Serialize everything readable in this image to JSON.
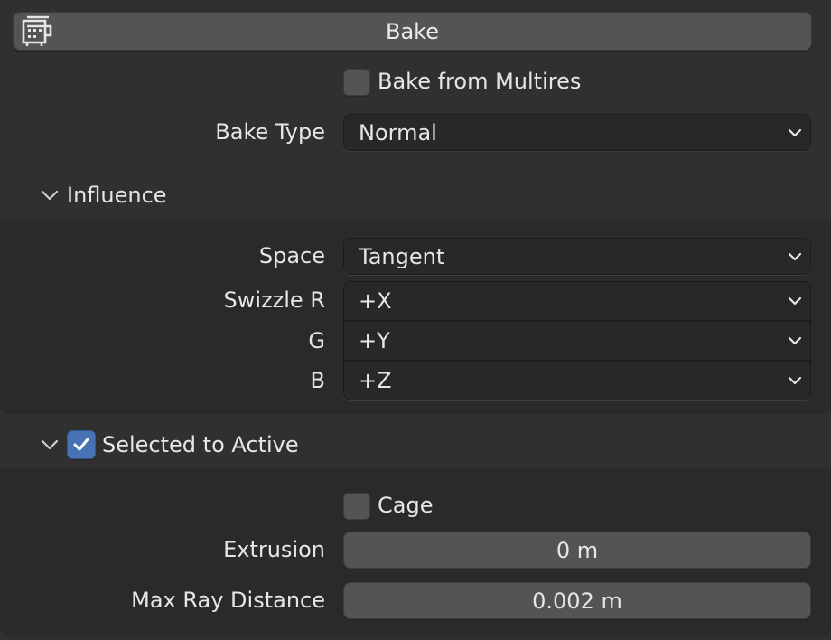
{
  "bake_button": {
    "label": "Bake",
    "icon": "render-bake-icon"
  },
  "bake_from_multires": {
    "label": "Bake from Multires",
    "checked": false
  },
  "bake_type": {
    "label": "Bake Type",
    "value": "Normal"
  },
  "influence": {
    "title": "Influence",
    "expanded": true,
    "space": {
      "label": "Space",
      "value": "Tangent"
    },
    "swizzle_r": {
      "label": "Swizzle R",
      "value": "+X"
    },
    "swizzle_g": {
      "label": "G",
      "value": "+Y"
    },
    "swizzle_b": {
      "label": "B",
      "value": "+Z"
    }
  },
  "selected_to_active": {
    "title": "Selected to Active",
    "expanded": true,
    "enabled": true,
    "cage": {
      "label": "Cage",
      "checked": false
    },
    "extrusion": {
      "label": "Extrusion",
      "value": "0 m"
    },
    "max_ray_distance": {
      "label": "Max Ray Distance",
      "value": "0.002 m"
    }
  },
  "colors": {
    "panel_bg": "#303030",
    "subpanel_bg": "#2a2a2a",
    "button_bg": "#545454",
    "dropdown_bg": "#282828",
    "accent_checked": "#4772b3"
  }
}
